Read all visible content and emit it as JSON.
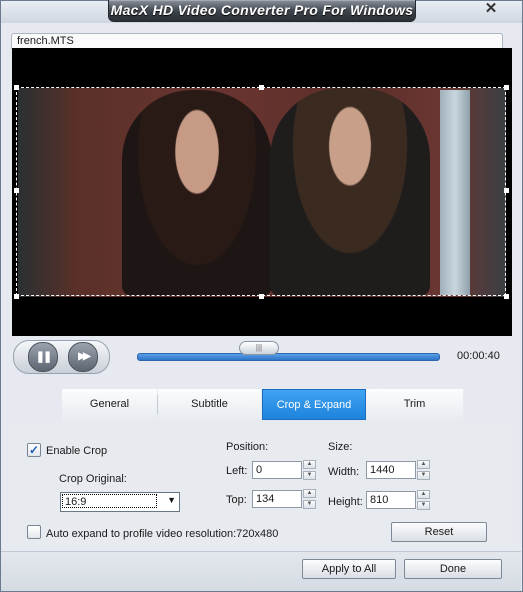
{
  "window": {
    "title": "MacX HD Video Converter Pro For Windows",
    "close_glyph": "✕"
  },
  "file": {
    "name": "french.MTS"
  },
  "player": {
    "time": "00:00:40",
    "progress": 0.43,
    "pause_glyph": "❚❚",
    "play_glyph": "▶▶",
    "knob_glyph": "|||"
  },
  "tabs": [
    {
      "label": "General"
    },
    {
      "label": "Subtitle"
    },
    {
      "label": "Crop & Expand",
      "active": true
    },
    {
      "label": "Trim"
    }
  ],
  "crop": {
    "enable_label": "Enable Crop",
    "enable_checked": true,
    "check_glyph": "✓",
    "original_label": "Crop Original:",
    "original_value": "16:9",
    "arrow_glyph": "▼",
    "position_label": "Position:",
    "size_label": "Size:",
    "left_label": "Left:",
    "left_value": "0",
    "top_label": "Top:",
    "top_value": "134",
    "width_label": "Width:",
    "width_value": "1440",
    "height_label": "Height:",
    "height_value": "810",
    "auto_expand_label": "Auto expand to profile video resolution:720x480",
    "auto_expand_checked": false,
    "reset_label": "Reset",
    "spin_up": "▲",
    "spin_down": "▼"
  },
  "footer": {
    "apply_all_label": "Apply to All",
    "done_label": "Done"
  }
}
